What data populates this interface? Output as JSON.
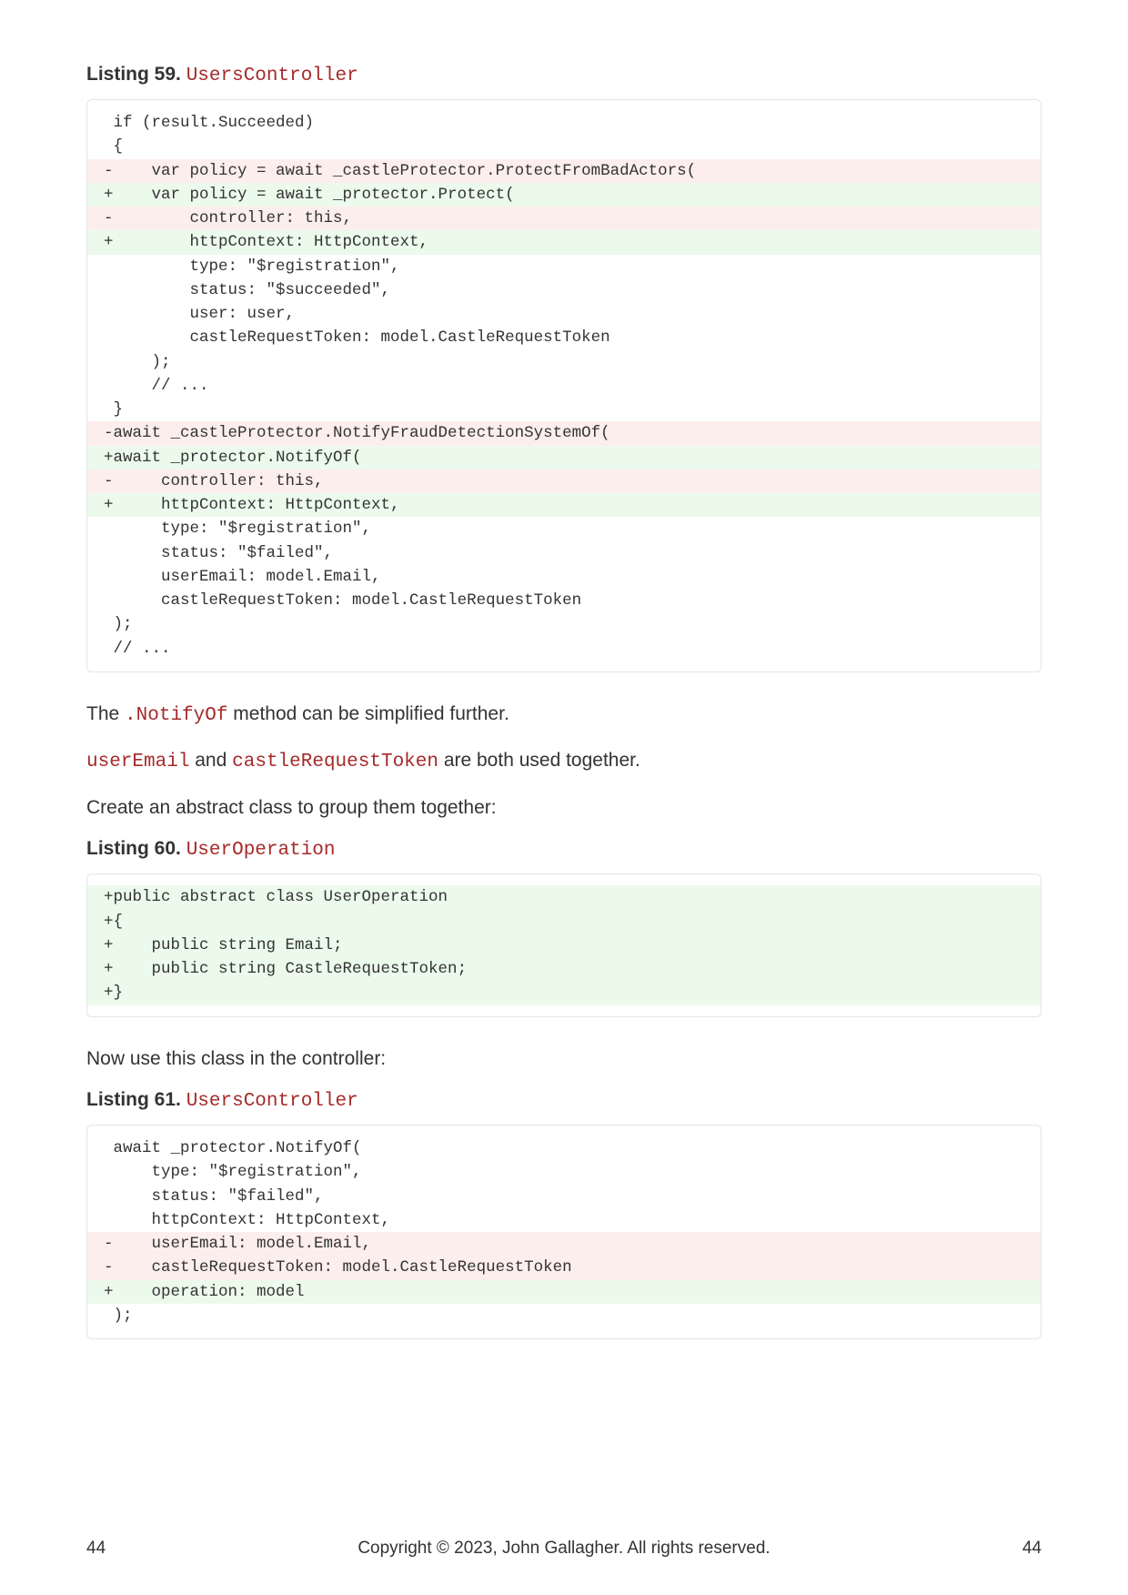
{
  "listing59": {
    "label": "Listing 59. ",
    "title": "UsersController",
    "lines": [
      {
        "t": "none",
        "c": " if (result.Succeeded)"
      },
      {
        "t": "none",
        "c": " {"
      },
      {
        "t": "removed",
        "c": "-    var policy = await _castleProtector.ProtectFromBadActors("
      },
      {
        "t": "added",
        "c": "+    var policy = await _protector.Protect("
      },
      {
        "t": "removed",
        "c": "-        controller: this,"
      },
      {
        "t": "added",
        "c": "+        httpContext: HttpContext,"
      },
      {
        "t": "none",
        "c": "         type: \"$registration\","
      },
      {
        "t": "none",
        "c": "         status: \"$succeeded\","
      },
      {
        "t": "none",
        "c": "         user: user,"
      },
      {
        "t": "none",
        "c": "         castleRequestToken: model.CastleRequestToken"
      },
      {
        "t": "none",
        "c": "     );"
      },
      {
        "t": "none",
        "c": "     // ..."
      },
      {
        "t": "none",
        "c": " }"
      },
      {
        "t": "none",
        "c": ""
      },
      {
        "t": "removed",
        "c": "-await _castleProtector.NotifyFraudDetectionSystemOf("
      },
      {
        "t": "added",
        "c": "+await _protector.NotifyOf("
      },
      {
        "t": "removed",
        "c": "-     controller: this,"
      },
      {
        "t": "added",
        "c": "+     httpContext: HttpContext,"
      },
      {
        "t": "none",
        "c": "      type: \"$registration\","
      },
      {
        "t": "none",
        "c": "      status: \"$failed\","
      },
      {
        "t": "none",
        "c": "      userEmail: model.Email,"
      },
      {
        "t": "none",
        "c": "      castleRequestToken: model.CastleRequestToken"
      },
      {
        "t": "none",
        "c": " );"
      },
      {
        "t": "none",
        "c": " // ..."
      }
    ]
  },
  "paragraphs": {
    "p1_a": "The ",
    "p1_code": ".NotifyOf",
    "p1_b": " method can be simplified further.",
    "p2_code1": "userEmail",
    "p2_a": " and ",
    "p2_code2": "castleRequestToken",
    "p2_b": " are both used together.",
    "p3": "Create an abstract class to group them together:",
    "p4": "Now use this class in the controller:"
  },
  "listing60": {
    "label": "Listing 60. ",
    "title": "UserOperation",
    "lines": [
      {
        "t": "added",
        "c": "+public abstract class UserOperation"
      },
      {
        "t": "added",
        "c": "+{"
      },
      {
        "t": "added",
        "c": "+    public string Email;"
      },
      {
        "t": "added",
        "c": "+    public string CastleRequestToken;"
      },
      {
        "t": "added",
        "c": "+}"
      }
    ]
  },
  "listing61": {
    "label": "Listing 61. ",
    "title": "UsersController",
    "lines": [
      {
        "t": "none",
        "c": " await _protector.NotifyOf("
      },
      {
        "t": "none",
        "c": "     type: \"$registration\","
      },
      {
        "t": "none",
        "c": "     status: \"$failed\","
      },
      {
        "t": "none",
        "c": "     httpContext: HttpContext,"
      },
      {
        "t": "removed",
        "c": "-    userEmail: model.Email,"
      },
      {
        "t": "removed",
        "c": "-    castleRequestToken: model.CastleRequestToken"
      },
      {
        "t": "added",
        "c": "+    operation: model"
      },
      {
        "t": "none",
        "c": " );"
      }
    ]
  },
  "footer": {
    "page_left": "44",
    "copyright": "Copyright © 2023, John Gallagher. All rights reserved.",
    "page_right": "44"
  }
}
